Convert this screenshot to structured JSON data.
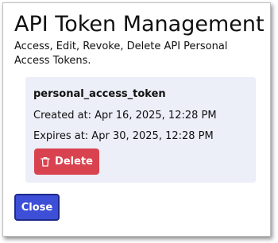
{
  "dialog": {
    "title": "API Token Management",
    "subtitle": "Access, Edit, Revoke, Delete API Personal Access Tokens."
  },
  "token": {
    "name": "personal_access_token",
    "created": "Created at: Apr 16, 2025, 12:28 PM",
    "expires": "Expires at: Apr 30, 2025, 12:28 PM",
    "delete_label": "Delete",
    "delete_icon": "trash-icon"
  },
  "footer": {
    "close_label": "Close"
  },
  "colors": {
    "delete_button": "#d9434f",
    "close_button": "#3d4fd6",
    "card_background": "#eceef8"
  }
}
